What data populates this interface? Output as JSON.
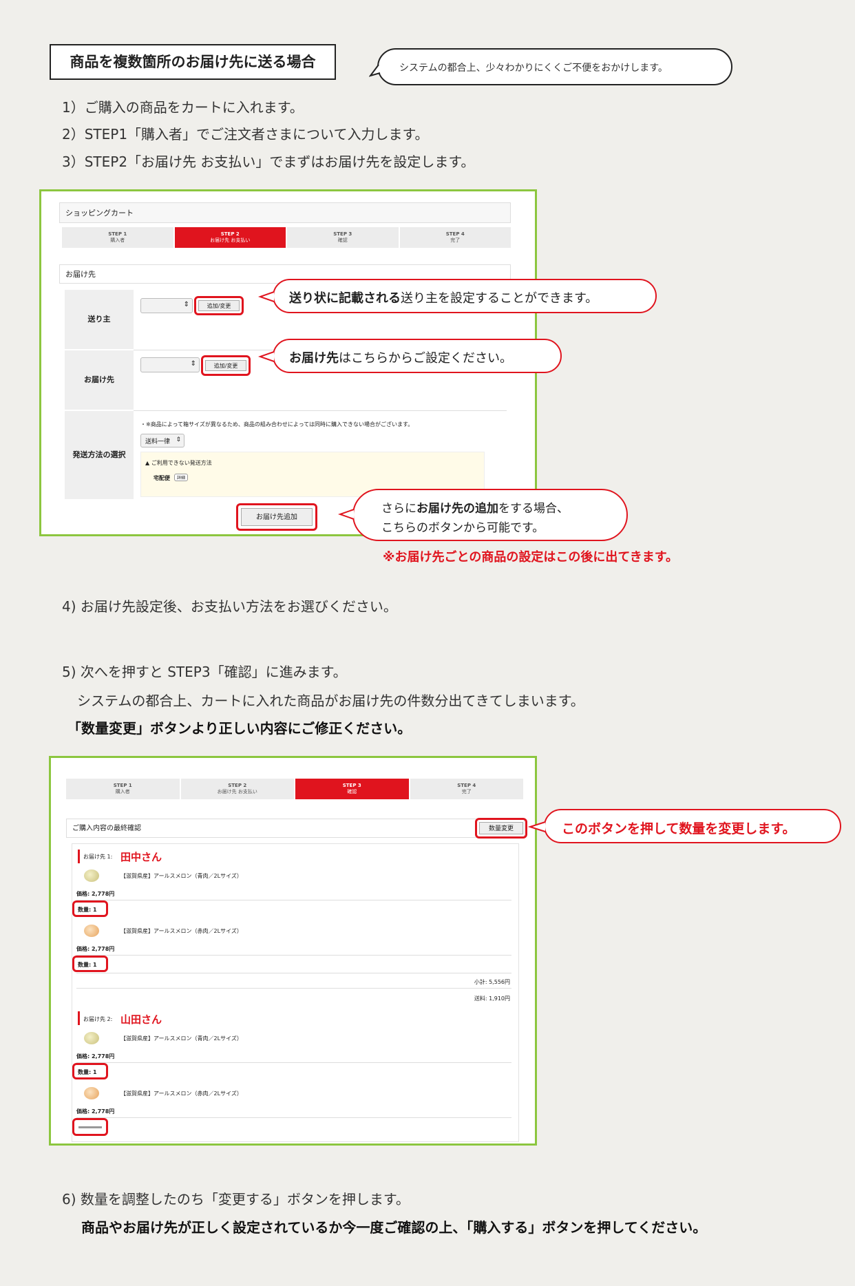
{
  "header": {
    "title": "商品を複数箇所のお届け先に送る場合",
    "note": "システムの都合上、少々わかりにくくご不便をおかけします。"
  },
  "steps_top": [
    "1）ご購入の商品をカートに入れます。",
    "2）STEP1「購入者」でご注文者さまについて入力します。",
    "3）STEP2「お届け先 お支払い」でまずはお届け先を設定します。"
  ],
  "shot1": {
    "cart_title": "ショッピングカート",
    "steps": [
      {
        "num": "STEP 1",
        "label": "購入者"
      },
      {
        "num": "STEP 2",
        "label": "お届け先 お支払い"
      },
      {
        "num": "STEP 3",
        "label": "確認"
      },
      {
        "num": "STEP 4",
        "label": "完了"
      }
    ],
    "section": "お届け先",
    "rows": {
      "sender": "送り主",
      "dest": "お届け先",
      "shipping": "発送方法の選択"
    },
    "add_change": "追加/変更",
    "shipping_note": "・※商品によって箱サイズが異なるため、商品の組み合わせによっては同時に購入できない場合がございます。",
    "shipping_select": "送料一律",
    "unavailable_label": "▲ ご利用できない発送方法",
    "unavailable_method": "宅配便",
    "detail": "詳細",
    "add_dest_button": "お届け先追加"
  },
  "callouts1": {
    "sender_bold": "送り状に記載される",
    "sender_rest": "送り主を設定することができます。",
    "dest_bold": "お届け先",
    "dest_rest": "はこちらからご設定ください。",
    "add_pre": "さらに",
    "add_bold": "お届け先の追加",
    "add_post": "をする場合、",
    "add_line2": "こちらのボタンから可能です。",
    "red_note": "※お届け先ごとの商品の設定はこの後に出てきます。"
  },
  "step4": "4) お届け先設定後、お支払い方法をお選びください。",
  "step5": {
    "line1": "5) 次へを押すと STEP3「確認」に進みます。",
    "line2": "システムの都合上、カートに入れた商品がお届け先の件数分出てきてしまいます。",
    "line3": "「数量変更」ボタンより正しい内容にご修正ください。"
  },
  "shot2": {
    "steps": [
      {
        "num": "STEP 1",
        "label": "購入者"
      },
      {
        "num": "STEP 2",
        "label": "お届け先 お支払い"
      },
      {
        "num": "STEP 3",
        "label": "確認"
      },
      {
        "num": "STEP 4",
        "label": "完了"
      }
    ],
    "confirm_title": "ご購入内容の最終確認",
    "qty_button": "数量変更",
    "dest1_label": "お届け先 1:",
    "dest1_name": "田中さん",
    "dest2_label": "お届け先 2:",
    "dest2_name": "山田さん",
    "item_green": "【滋賀県産】アールスメロン（青肉／2Lサイズ）",
    "item_red": "【滋賀県産】アールスメロン（赤肉／2Lサイズ）",
    "price": "価格: 2,778円",
    "qty": "数量: 1",
    "subtotal": "小計: 5,556円",
    "shipping": "送料: 1,910円"
  },
  "callout2": "このボタンを押して数量を変更します。",
  "step6": {
    "line1": "6) 数量を調整したのち「変更する」ボタンを押します。",
    "line2": "商品やお届け先が正しく設定されているか今一度ご確認の上、「購入する」ボタンを押してください。"
  },
  "colors": {
    "accent_red": "#e0141e",
    "frame_green": "#8cc63f",
    "page_bg": "#f0efeb"
  }
}
